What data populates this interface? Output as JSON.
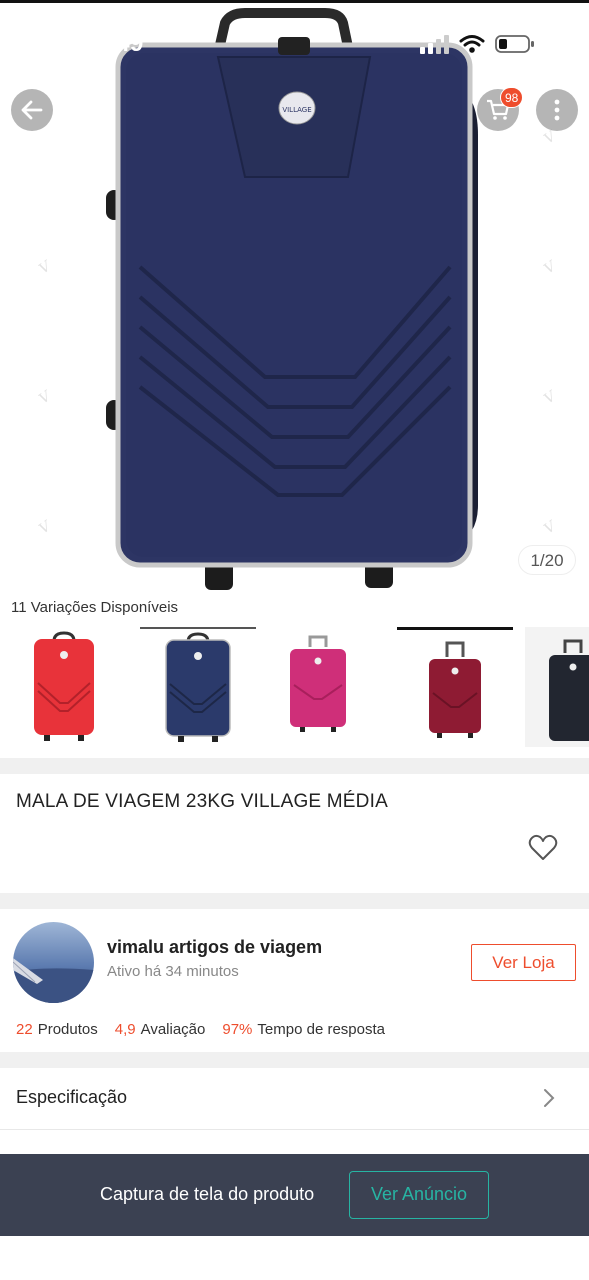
{
  "status_bar": {
    "time": "12:49"
  },
  "header": {
    "cart_badge": "98",
    "back_icon": "arrow-left-icon",
    "cart_icon": "cart-icon",
    "more_icon": "more-vertical-icon"
  },
  "gallery": {
    "counter": "1/20",
    "brand_logo_text": "VILLAGE"
  },
  "variations": {
    "label": "11 Variações Disponíveis",
    "items": [
      {
        "color": "#e8333a"
      },
      {
        "color": "#2b3a6b"
      },
      {
        "color": "#cf2f79"
      },
      {
        "color": "#8e1b33"
      },
      {
        "color": "#222630"
      }
    ]
  },
  "product": {
    "title": "MALA DE VIAGEM 23KG VILLAGE MÉDIA",
    "favorite_icon": "heart-icon"
  },
  "shop": {
    "name": "vimalu artigos de viagem",
    "active": "Ativo há 34 minutos",
    "visit_label": "Ver Loja",
    "stats": [
      {
        "value": "22",
        "label": "Produtos"
      },
      {
        "value": "4,9",
        "label": "Avaliação"
      },
      {
        "value": "97%",
        "label": "Tempo de resposta"
      }
    ]
  },
  "spec": {
    "label": "Especificação",
    "chevron_icon": "chevron-right-icon"
  },
  "bottom_bar": {
    "capture_text": "Captura de tela do produto",
    "ad_button": "Ver Anúncio"
  },
  "colors": {
    "accent": "#ee4d2d",
    "teal": "#27b4a3",
    "bar_bg": "#3b4152"
  }
}
